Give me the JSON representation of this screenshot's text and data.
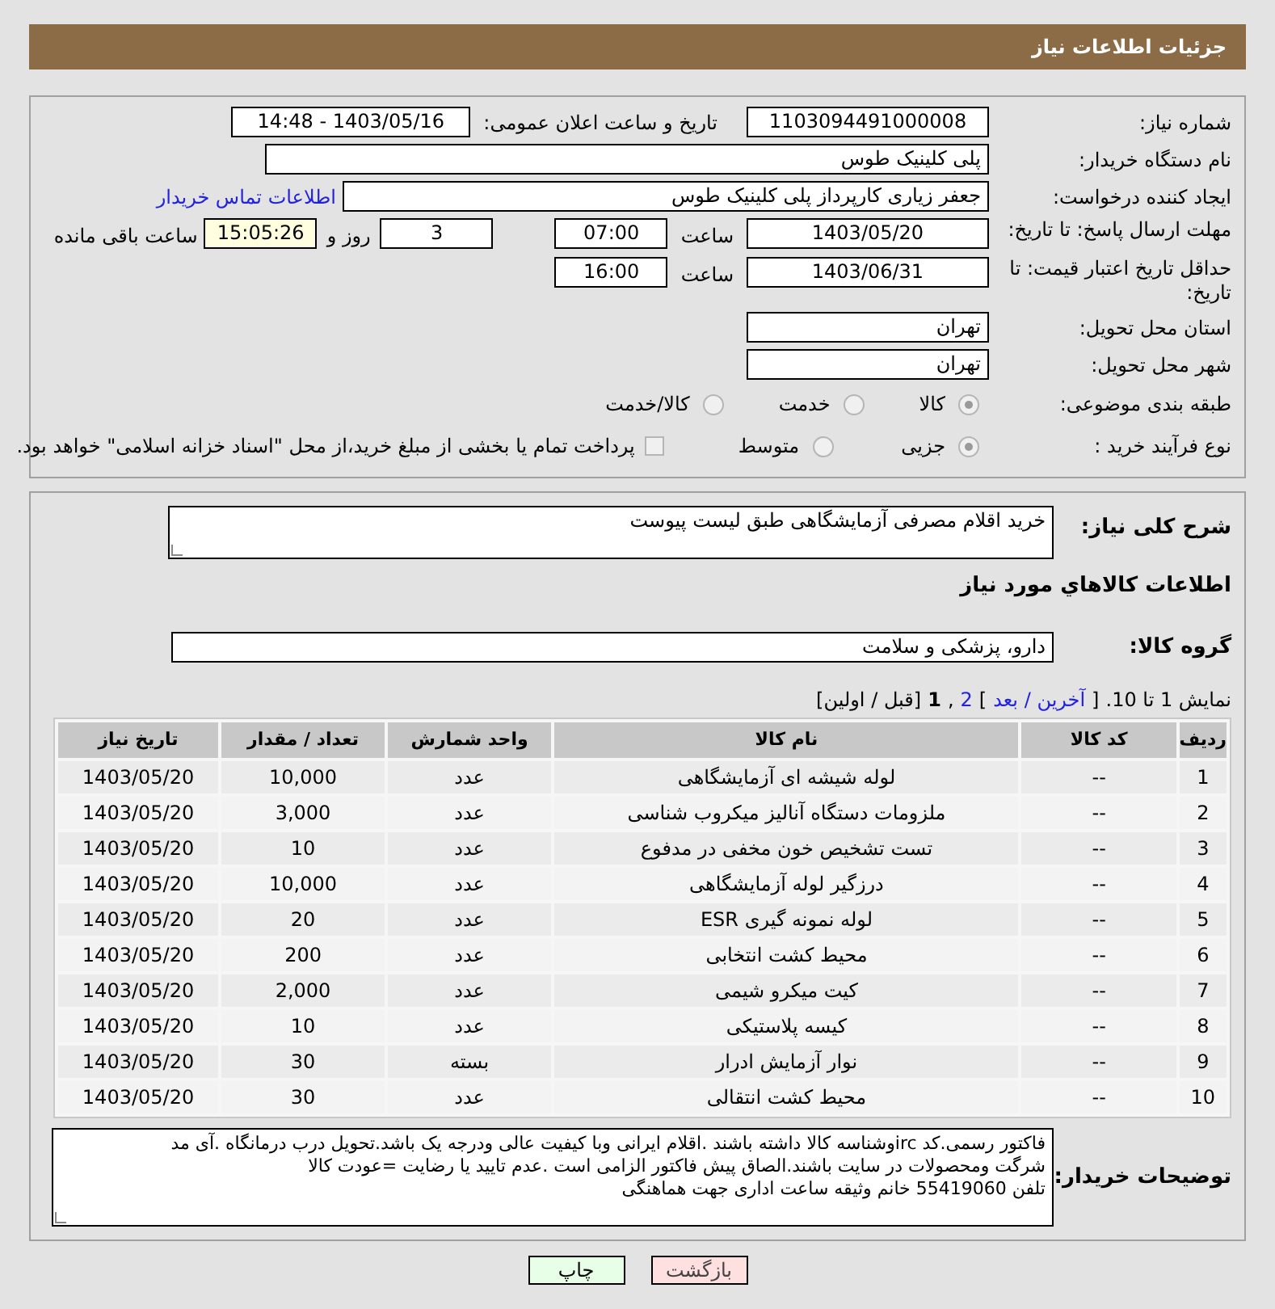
{
  "header": {
    "title": "جزئیات اطلاعات نیاز"
  },
  "info": {
    "need_number_label": "شماره نیاز:",
    "need_number": "1103094491000008",
    "announce_label": "تاریخ و ساعت اعلان عمومی:",
    "announce": "1403/05/16 - 14:48",
    "buyer_label": "نام دستگاه خریدار:",
    "buyer": "پلی کلینیک طوس",
    "creator_label": "ایجاد کننده درخواست:",
    "creator": "جعفر زیاری کارپرداز پلی کلینیک طوس",
    "contact_link": "اطلاعات تماس خریدار",
    "deadline_label": "مهلت ارسال پاسخ: تا تاریخ:",
    "deadline_date": "1403/05/20",
    "time_label": "ساعت",
    "deadline_time": "07:00",
    "days": "3",
    "days_label": "روز و",
    "remaining": "15:05:26",
    "remaining_label": "ساعت باقی مانده",
    "validity_label": "حداقل تاریخ اعتبار قیمت: تا تاریخ:",
    "validity_date": "1403/06/31",
    "validity_time_label": "ساعت",
    "validity_time": "16:00",
    "province_label": "استان محل تحویل:",
    "province": "تهران",
    "city_label": "شهر محل تحویل:",
    "city": "تهران",
    "category_label": "طبقه بندی موضوعی:",
    "category_options": [
      {
        "label": "کالا",
        "selected": true
      },
      {
        "label": "خدمت",
        "selected": false
      },
      {
        "label": "کالا/خدمت",
        "selected": false
      }
    ],
    "process_label": "نوع فرآیند خرید :",
    "process_options": [
      {
        "label": "جزیی",
        "selected": true
      },
      {
        "label": "متوسط",
        "selected": false
      }
    ],
    "payment": {
      "label": "پرداخت تمام یا بخشی از مبلغ خرید،از محل \"اسناد خزانه اسلامی\" خواهد بود.",
      "checked": false
    }
  },
  "summary": {
    "label": "شرح کلی نیاز:",
    "value": "خرید اقلام مصرفی آزمایشگاهی طبق لیست پیوست"
  },
  "goods_title": "اطلاعات کالاهاي مورد نياز",
  "group": {
    "label": "گروه کالا:",
    "value": "دارو، پزشکی و سلامت"
  },
  "pagination": [
    {
      "text": "نمایش 1 تا 10.",
      "kind": "plain"
    },
    {
      "text": "[",
      "kind": "plain"
    },
    {
      "text": "آخرین / بعد",
      "kind": "link"
    },
    {
      "text": "]",
      "kind": "plain"
    },
    {
      "text": "2",
      "kind": "link"
    },
    {
      "text": ",",
      "kind": "plain"
    },
    {
      "text": "1",
      "kind": "current"
    },
    {
      "text": "[قبل / اولین]",
      "kind": "plain"
    }
  ],
  "table": {
    "columns": [
      "ردیف",
      "کد کالا",
      "نام کالا",
      "واحد شمارش",
      "تعداد / مقدار",
      "تاریخ نیاز"
    ],
    "rows": [
      [
        "1",
        "--",
        "لوله شیشه ای آزمایشگاهی",
        "عدد",
        "10,000",
        "1403/05/20"
      ],
      [
        "2",
        "--",
        "ملزومات دستگاه آنالیز میکروب شناسی",
        "عدد",
        "3,000",
        "1403/05/20"
      ],
      [
        "3",
        "--",
        "تست تشخیص خون مخفی در مدفوع",
        "عدد",
        "10",
        "1403/05/20"
      ],
      [
        "4",
        "--",
        "درزگیر لوله آزمایشگاهی",
        "عدد",
        "10,000",
        "1403/05/20"
      ],
      [
        "5",
        "--",
        "لوله نمونه گیری ESR",
        "عدد",
        "20",
        "1403/05/20"
      ],
      [
        "6",
        "--",
        "محیط کشت انتخابی",
        "عدد",
        "200",
        "1403/05/20"
      ],
      [
        "7",
        "--",
        "کیت میکرو شیمی",
        "عدد",
        "2,000",
        "1403/05/20"
      ],
      [
        "8",
        "--",
        "کیسه پلاستیکی",
        "عدد",
        "10",
        "1403/05/20"
      ],
      [
        "9",
        "--",
        "نوار آزمایش ادرار",
        "بسته",
        "30",
        "1403/05/20"
      ],
      [
        "10",
        "--",
        "محیط کشت انتقالی",
        "عدد",
        "30",
        "1403/05/20"
      ]
    ]
  },
  "notes": {
    "label": "توضیحات خریدار:",
    "lines": [
      "فاکتور رسمی.کد ircوشناسه کالا داشته باشند .اقلام ایرانی وبا کیفیت عالی ودرجه یک باشد.تحویل درب درمانگاه .آی مد",
      "شرگت ومحصولات در سایت باشند.الصاق پیش فاکتور الزامی است .عدم تایید یا رضایت =عودت کالا",
      "تلفن 55419060 خانم وثیقه ساعت اداری جهت هماهنگی"
    ]
  },
  "buttons": [
    {
      "label": "بازگشت",
      "kind": "back"
    },
    {
      "label": "چاپ",
      "kind": "print"
    }
  ]
}
